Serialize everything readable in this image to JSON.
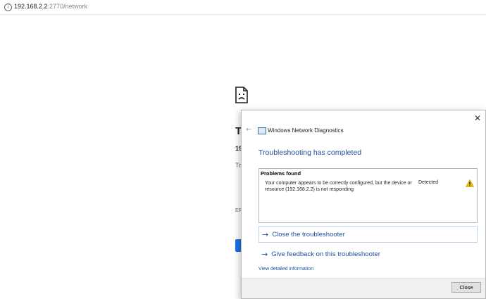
{
  "browser": {
    "info_icon": "info-icon",
    "url_host": "192.168.2.2",
    "url_rest": ":2770/network"
  },
  "error_page": {
    "title_fragment": "T",
    "line2_fragment": "19",
    "line3_fragment": "Try",
    "line4_fragment": "ERI"
  },
  "dialog": {
    "back_icon": "back-arrow-icon",
    "app_title": "Windows Network Diagnostics",
    "heading": "Troubleshooting has completed",
    "problems_header": "Problems found",
    "problem_description": "Your computer appears to be correctly configured, but the device or resource (192.168.2.2) is not responding",
    "problem_status": "Detected",
    "actions": [
      {
        "label": "Close the troubleshooter"
      },
      {
        "label": "Give feedback on this troubleshooter"
      }
    ],
    "detail_link": "View detailed information",
    "close_button": "Close"
  },
  "colors": {
    "accent": "#1e4e9e",
    "warning": "#f2c200",
    "chrome_button": "#1a73e8"
  }
}
